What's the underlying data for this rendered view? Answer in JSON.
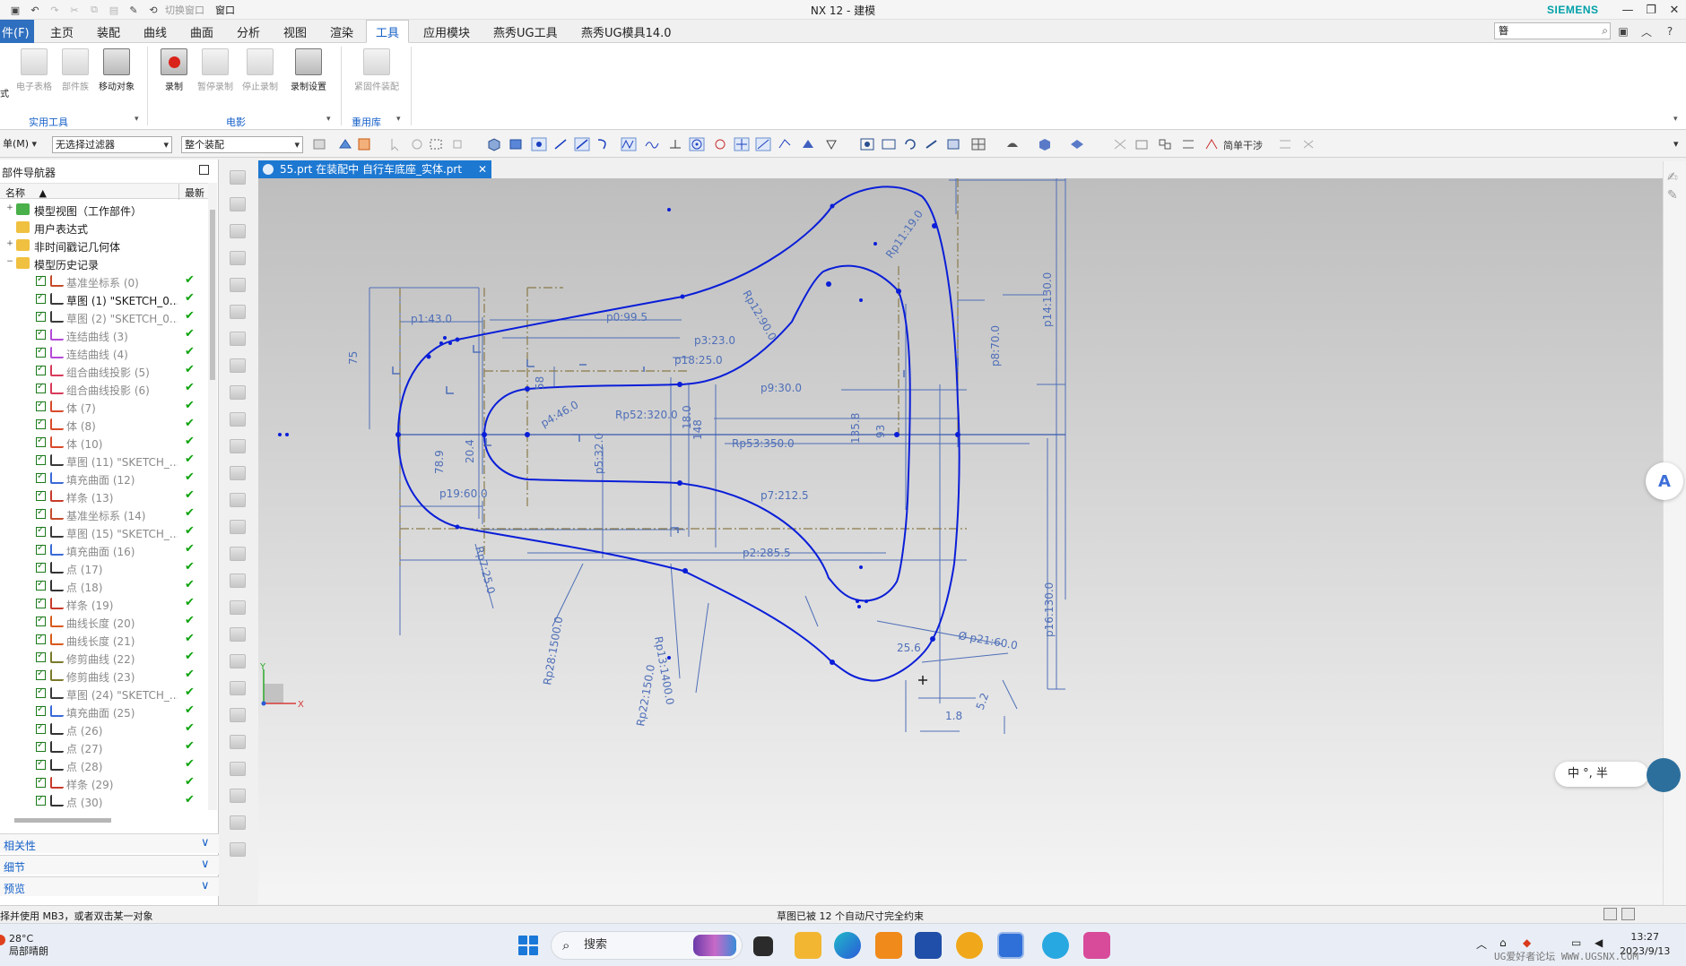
{
  "window": {
    "title": "NX 12 - 建模",
    "brand": "SIEMENS",
    "qat_switch_window": "切换窗口",
    "qat_window": "窗口"
  },
  "tabs": {
    "file": "件(F)",
    "items": [
      "主页",
      "装配",
      "曲线",
      "曲面",
      "分析",
      "视图",
      "渲染",
      "工具",
      "应用模块",
      "燕秀UG工具",
      "燕秀UG模具14.0"
    ],
    "active_index": 7,
    "search_value": "簪"
  },
  "ribbon": {
    "left_cut": "式",
    "groups": [
      {
        "label": "实用工具",
        "buttons": [
          "电子表格",
          "部件族",
          "移动对象"
        ]
      },
      {
        "label": "电影",
        "buttons": [
          "录制",
          "暂停录制",
          "停止录制",
          "录制设置"
        ]
      },
      {
        "label": "重用库",
        "buttons": [
          "紧固件装配"
        ]
      }
    ]
  },
  "selbar": {
    "menu": "单(M)",
    "filter": "无选择过滤器",
    "scope": "整个装配",
    "simple_trace": "简单干涉"
  },
  "navigator": {
    "title": "部件导航器",
    "col_name": "名称",
    "col_latest": "最新",
    "top_rows": [
      {
        "label": "模型视图（工作部件）",
        "exp": "+"
      },
      {
        "label": "用户表达式",
        "exp": ""
      },
      {
        "label": "非时间戳记几何体",
        "exp": "+"
      },
      {
        "label": "模型历史记录",
        "exp": "−"
      }
    ],
    "features": [
      {
        "label": "基准坐标系 (0)",
        "icon": "datum-csys",
        "dim": true
      },
      {
        "label": "草图 (1) \"SKETCH_0...",
        "icon": "sketch",
        "dim": false
      },
      {
        "label": "草图 (2) \"SKETCH_0...",
        "icon": "sketch",
        "dim": true
      },
      {
        "label": "连结曲线 (3)",
        "icon": "join-curve",
        "dim": true
      },
      {
        "label": "连结曲线 (4)",
        "icon": "join-curve",
        "dim": true
      },
      {
        "label": "组合曲线投影 (5)",
        "icon": "combined-projection",
        "dim": true
      },
      {
        "label": "组合曲线投影 (6)",
        "icon": "combined-projection",
        "dim": true
      },
      {
        "label": "体 (7)",
        "icon": "body",
        "dim": true
      },
      {
        "label": "体 (8)",
        "icon": "body",
        "dim": true
      },
      {
        "label": "体 (10)",
        "icon": "body",
        "dim": true
      },
      {
        "label": "草图 (11) \"SKETCH_...",
        "icon": "sketch",
        "dim": true
      },
      {
        "label": "填充曲面 (12)",
        "icon": "fill-surface",
        "dim": true
      },
      {
        "label": "样条 (13)",
        "icon": "spline",
        "dim": true
      },
      {
        "label": "基准坐标系 (14)",
        "icon": "datum-csys",
        "dim": true
      },
      {
        "label": "草图 (15) \"SKETCH_...",
        "icon": "sketch",
        "dim": true
      },
      {
        "label": "填充曲面 (16)",
        "icon": "fill-surface",
        "dim": true
      },
      {
        "label": "点 (17)",
        "icon": "point",
        "dim": true
      },
      {
        "label": "点 (18)",
        "icon": "point",
        "dim": true
      },
      {
        "label": "样条 (19)",
        "icon": "spline",
        "dim": true
      },
      {
        "label": "曲线长度 (20)",
        "icon": "curve-length",
        "dim": true
      },
      {
        "label": "曲线长度 (21)",
        "icon": "curve-length",
        "dim": true
      },
      {
        "label": "修剪曲线 (22)",
        "icon": "trim-curve",
        "dim": true
      },
      {
        "label": "修剪曲线 (23)",
        "icon": "trim-curve",
        "dim": true
      },
      {
        "label": "草图 (24) \"SKETCH_...",
        "icon": "sketch",
        "dim": true
      },
      {
        "label": "填充曲面 (25)",
        "icon": "fill-surface",
        "dim": true
      },
      {
        "label": "点 (26)",
        "icon": "point",
        "dim": true
      },
      {
        "label": "点 (27)",
        "icon": "point",
        "dim": true
      },
      {
        "label": "点 (28)",
        "icon": "point",
        "dim": true
      },
      {
        "label": "样条 (29)",
        "icon": "spline",
        "dim": true
      },
      {
        "label": "点 (30)",
        "icon": "point",
        "dim": true
      }
    ],
    "panels": [
      "相关性",
      "细节",
      "预览"
    ]
  },
  "doc_tab": "55.prt 在装配中 自行车底座_实体.prt",
  "dimensions": [
    "p1:43.0",
    "p0:99.5",
    "p3:23.0",
    "p18:25.0",
    "75",
    "Rp12:90.0",
    "Rp11:19.0",
    "p14:130.0",
    "p8:70.0",
    "p9:30.0",
    "Rp52:320.0",
    "p4:46.0",
    "58",
    "20.4",
    "78.9",
    "p5:32.0",
    "18.0",
    "148",
    "135.8",
    "93",
    "Rp53:350.0",
    "p19:60.0",
    "p7:212.5",
    "Rp7:25.0",
    "p2:285.5",
    "Rp28:1500.0",
    "Rp13:1400.0",
    "Rp22:150.0",
    "25.6",
    "Ø p21:60.0",
    "p16:130.0",
    "5.2",
    "1.8",
    "X",
    "Y"
  ],
  "status": {
    "prompt": "择并使用 MB3，或者双击某一对象",
    "message": "草图已被 12 个自动尺寸完全约束"
  },
  "ime": "中 °, 半",
  "taskbar": {
    "temp": "28°C",
    "weather": "局部晴朗",
    "search": "搜索",
    "time": "13:27",
    "date": "2023/9/13"
  },
  "watermark": "UG爱好者论坛 WWW.UGSNX.COM",
  "colors": {
    "accent": "#1d78d2",
    "sketch_curve": "#0a1ed8",
    "dimension": "#4f6fb8",
    "ok": "#0da30d"
  }
}
